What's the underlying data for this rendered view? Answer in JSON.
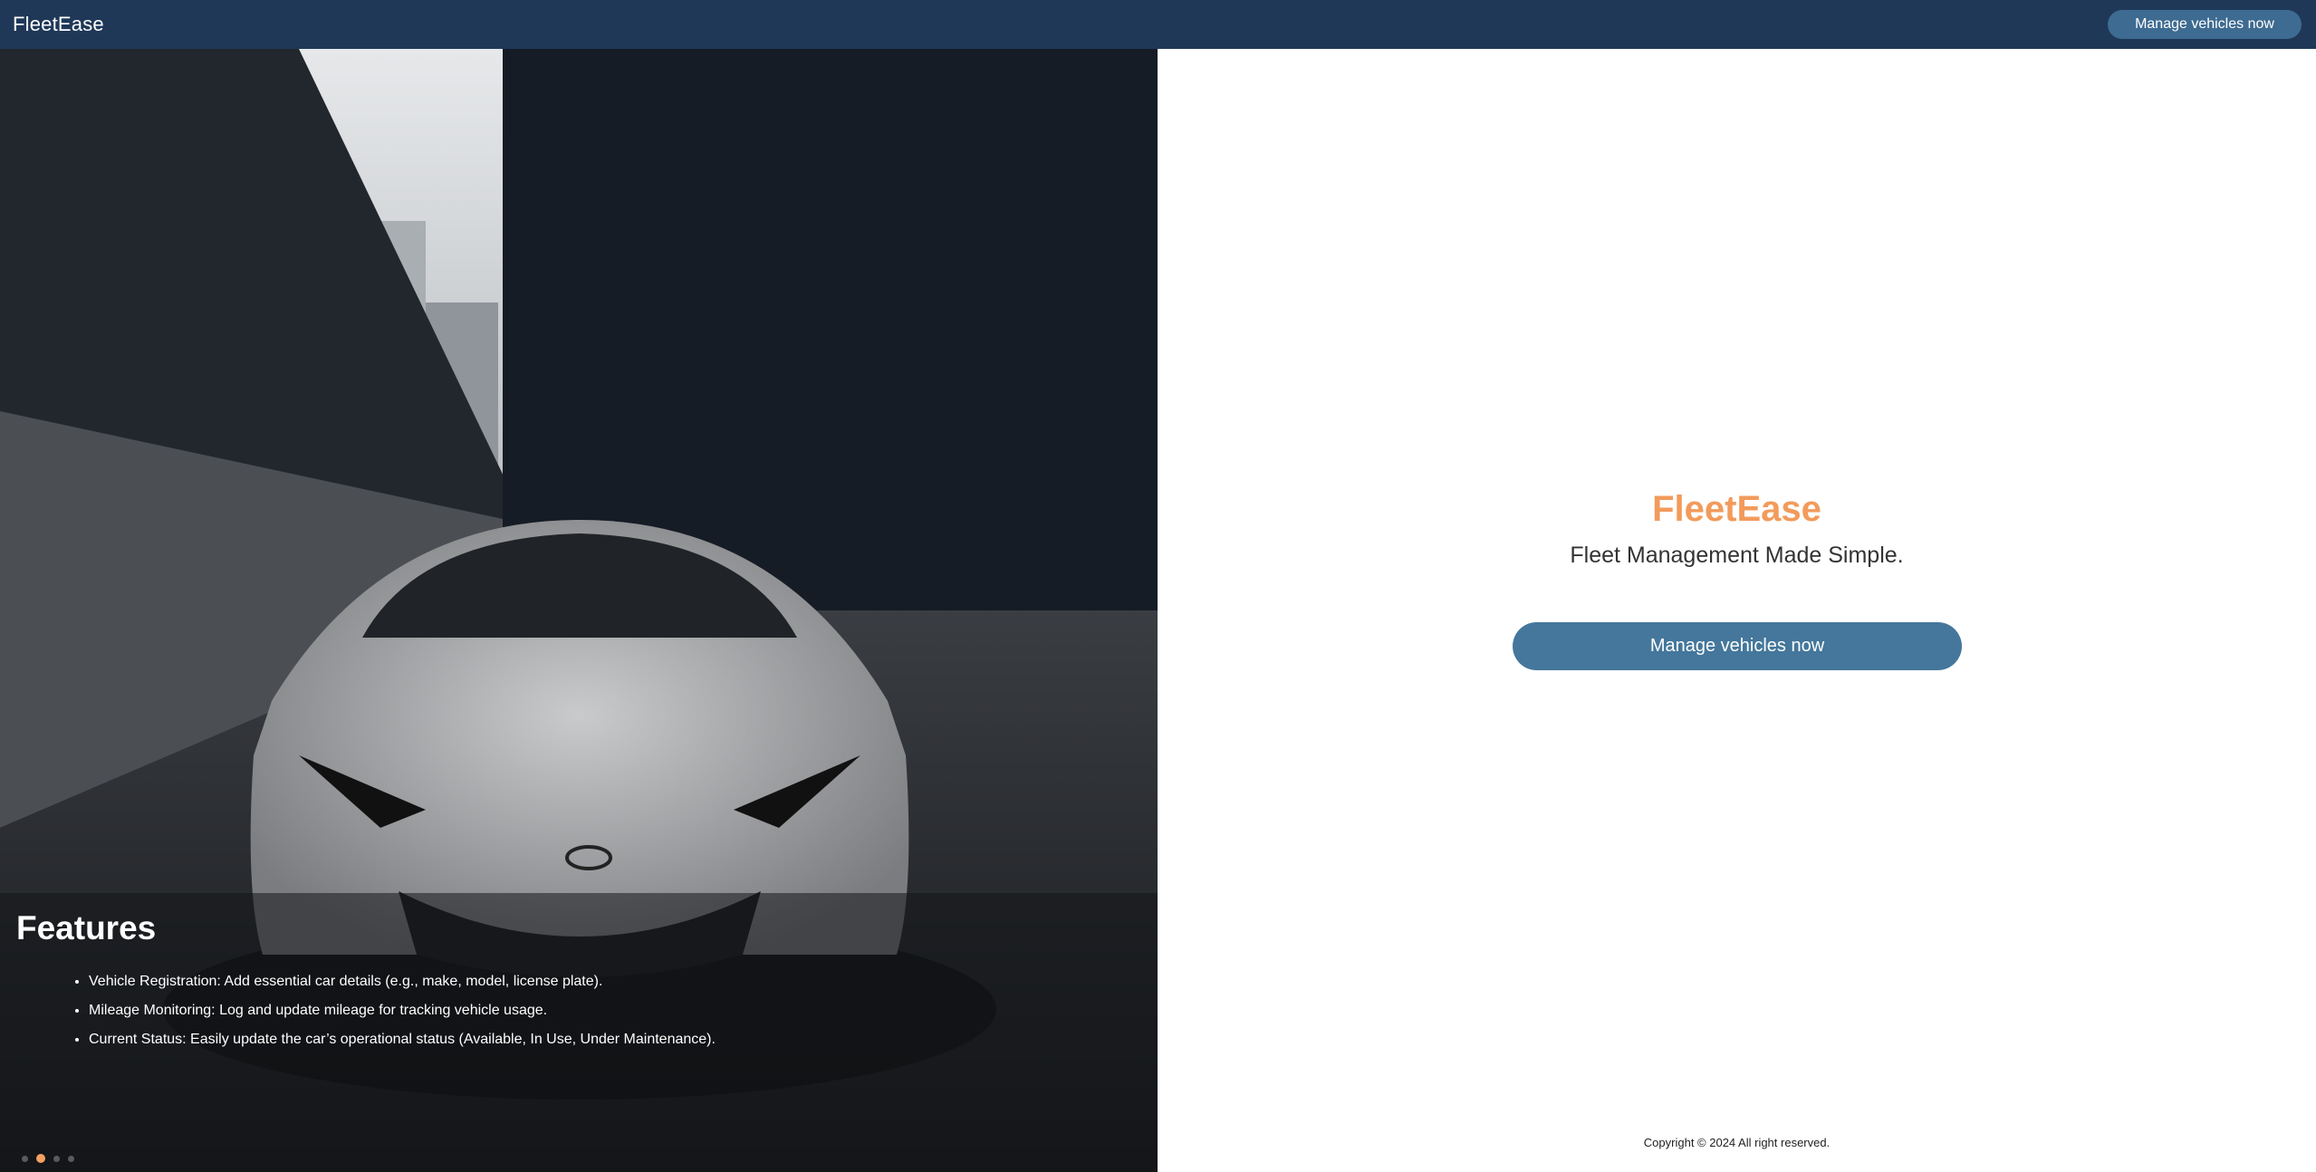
{
  "navbar": {
    "brand": "FleetEase",
    "cta_label": "Manage vehicles now"
  },
  "carousel": {
    "features_title": "Features",
    "features": [
      "Vehicle Registration: Add essential car details (e.g., make, model, license plate).",
      "Mileage Monitoring: Log and update mileage for tracking vehicle usage.",
      "Current Status: Easily update the car’s operational status (Available, In Use, Under Maintenance)."
    ],
    "slide_count": 4,
    "active_slide": 2
  },
  "hero": {
    "title": "FleetEase",
    "subtitle": "Fleet Management Made Simple.",
    "cta_label": "Manage vehicles now"
  },
  "footer": {
    "copyright": "Copyright © 2024 All right reserved."
  },
  "colors": {
    "navbar_bg": "#1f3858",
    "accent_orange": "#f29b5b",
    "cta_blue": "#44779b"
  }
}
